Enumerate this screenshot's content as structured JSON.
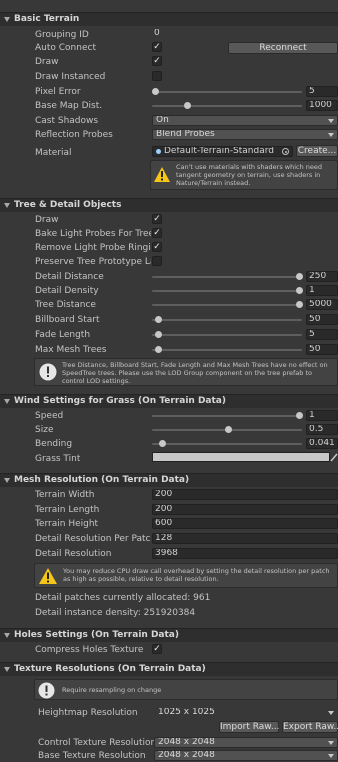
{
  "basic_terrain": {
    "title": "Basic Terrain",
    "grouping_id": {
      "label": "Grouping ID",
      "value": "0"
    },
    "auto_connect": {
      "label": "Auto Connect",
      "checked": true,
      "button": "Reconnect"
    },
    "draw": {
      "label": "Draw",
      "checked": true
    },
    "draw_instanced": {
      "label": "Draw Instanced",
      "checked": false
    },
    "pixel_error": {
      "label": "Pixel Error",
      "value": "5",
      "fraction": 0.02
    },
    "base_map_dist": {
      "label": "Base Map Dist.",
      "value": "1000",
      "fraction": 0.25
    },
    "cast_shadows": {
      "label": "Cast Shadows",
      "value": "On"
    },
    "reflection_probes": {
      "label": "Reflection Probes",
      "value": "Blend Probes"
    },
    "material": {
      "label": "Material",
      "value": "Default-Terrain-Standard",
      "button": "Create..."
    },
    "material_warning": "Can't use materials with shaders which need tangent geometry on terrain, use shaders in Nature/Terrain instead."
  },
  "tree_detail": {
    "title": "Tree & Detail Objects",
    "draw": {
      "label": "Draw",
      "checked": true
    },
    "bake_light_probes": {
      "label": "Bake Light Probes For Trees",
      "checked": true
    },
    "remove_light_probe_ringing": {
      "label": "Remove Light Probe Ringing",
      "checked": true
    },
    "preserve_tree_prototype": {
      "label": "Preserve Tree Prototype Layers",
      "checked": false
    },
    "detail_distance": {
      "label": "Detail Distance",
      "value": "250",
      "fraction": 1.0
    },
    "detail_density": {
      "label": "Detail Density",
      "value": "1",
      "fraction": 1.0
    },
    "tree_distance": {
      "label": "Tree Distance",
      "value": "5000",
      "fraction": 1.0
    },
    "billboard_start": {
      "label": "Billboard Start",
      "value": "50",
      "fraction": 0.03
    },
    "fade_length": {
      "label": "Fade Length",
      "value": "5",
      "fraction": 0.03
    },
    "max_mesh_trees": {
      "label": "Max Mesh Trees",
      "value": "50",
      "fraction": 0.03
    },
    "info": "Tree Distance, Billboard Start, Fade Length and Max Mesh Trees have no effect on SpeedTree trees. Please use the LOD Group component on the tree prefab to control LOD settings."
  },
  "wind": {
    "title": "Wind Settings for Grass (On Terrain Data)",
    "speed": {
      "label": "Speed",
      "value": "1",
      "fraction": 1.0
    },
    "size": {
      "label": "Size",
      "value": "0.5",
      "fraction": 0.5
    },
    "bending": {
      "label": "Bending",
      "value": "0.041",
      "fraction": 0.05
    },
    "grass_tint": {
      "label": "Grass Tint",
      "color": "#c8c8c8"
    }
  },
  "mesh_resolution": {
    "title": "Mesh Resolution (On Terrain Data)",
    "terrain_width": {
      "label": "Terrain Width",
      "value": "200"
    },
    "terrain_length": {
      "label": "Terrain Length",
      "value": "200"
    },
    "terrain_height": {
      "label": "Terrain Height",
      "value": "600"
    },
    "detail_resolution_per_patch": {
      "label": "Detail Resolution Per Patch",
      "value": "128"
    },
    "detail_resolution": {
      "label": "Detail Resolution",
      "value": "3968"
    },
    "warning": "You may reduce CPU draw call overhead by setting the detail resolution per patch as high as possible, relative to detail resolution.",
    "patches_allocated": "Detail patches currently allocated: 961",
    "instance_density": "Detail instance density: 251920384"
  },
  "holes": {
    "title": "Holes Settings (On Terrain Data)",
    "compress": {
      "label": "Compress Holes Texture",
      "checked": true
    }
  },
  "texture_resolutions": {
    "title": "Texture Resolutions (On Terrain Data)",
    "info": "Require resampling on change",
    "heightmap": {
      "label": "Heightmap Resolution",
      "value": "1025 x 1025"
    },
    "import_raw": "Import Raw...",
    "export_raw": "Export Raw...",
    "control_texture": {
      "label": "Control Texture Resolution",
      "value": "2048 x 2048"
    },
    "base_texture": {
      "label": "Base Texture Resolution",
      "value": "2048 x 2048"
    }
  },
  "colors": {
    "background": "#383838",
    "header": "#2e2e2e",
    "warning": "#f5c518",
    "info": "#e6e6e6"
  }
}
